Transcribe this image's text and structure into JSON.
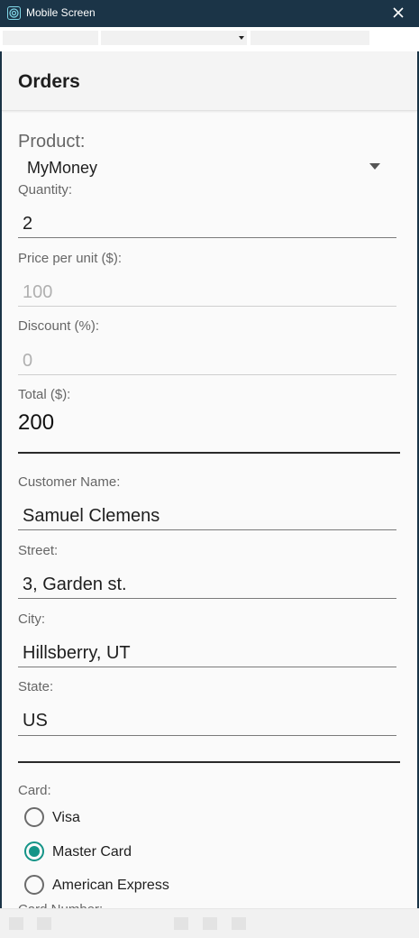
{
  "window": {
    "title": "Mobile Screen"
  },
  "page": {
    "title": "Orders"
  },
  "product": {
    "label": "Product:",
    "value": "MyMoney"
  },
  "quantity": {
    "label": "Quantity:",
    "value": "2"
  },
  "price": {
    "label": "Price per unit ($):",
    "value": "100"
  },
  "discount": {
    "label": "Discount (%):",
    "value": "0"
  },
  "total": {
    "label": "Total ($):",
    "value": "200"
  },
  "customer": {
    "name_label": "Customer Name:",
    "name": "Samuel Clemens",
    "street_label": "Street:",
    "street": "3, Garden st.",
    "city_label": "City:",
    "city": "Hillsberry, UT",
    "state_label": "State:",
    "state": "US"
  },
  "card": {
    "label": "Card:",
    "options": [
      "Visa",
      "Master Card",
      "American Express"
    ],
    "selected": "Master Card"
  },
  "card_number": {
    "label": "Card Number:"
  },
  "colors": {
    "accent": "#149487",
    "titlebar": "#1b3447"
  }
}
